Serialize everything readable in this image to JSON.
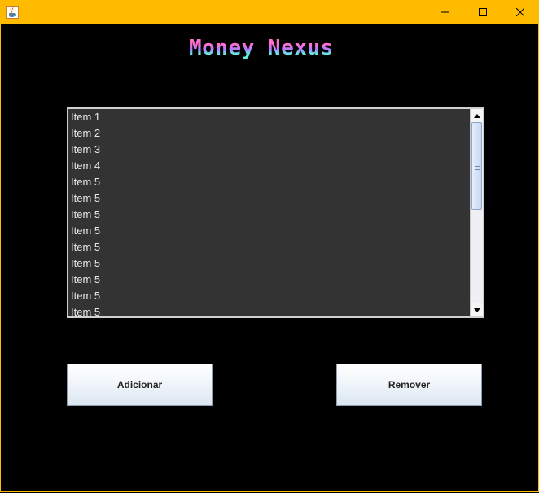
{
  "window": {
    "icon": "java-coffee-cup-icon",
    "controls": [
      "minimize-icon",
      "maximize-icon",
      "close-icon"
    ]
  },
  "logo": {
    "text": "Money Nexus"
  },
  "list": {
    "items": [
      "Item 1",
      "Item 2",
      "Item 3",
      "Item 4",
      "Item 5",
      "Item 5",
      "Item 5",
      "Item 5",
      "Item 5",
      "Item 5",
      "Item 5",
      "Item 5",
      "Item 5"
    ]
  },
  "buttons": {
    "add_label": "Adicionar",
    "remove_label": "Remover"
  },
  "colors": {
    "titlebar": "#ffbb00",
    "background": "#000000",
    "list_bg": "#333333",
    "list_text": "#e8e8e8"
  }
}
